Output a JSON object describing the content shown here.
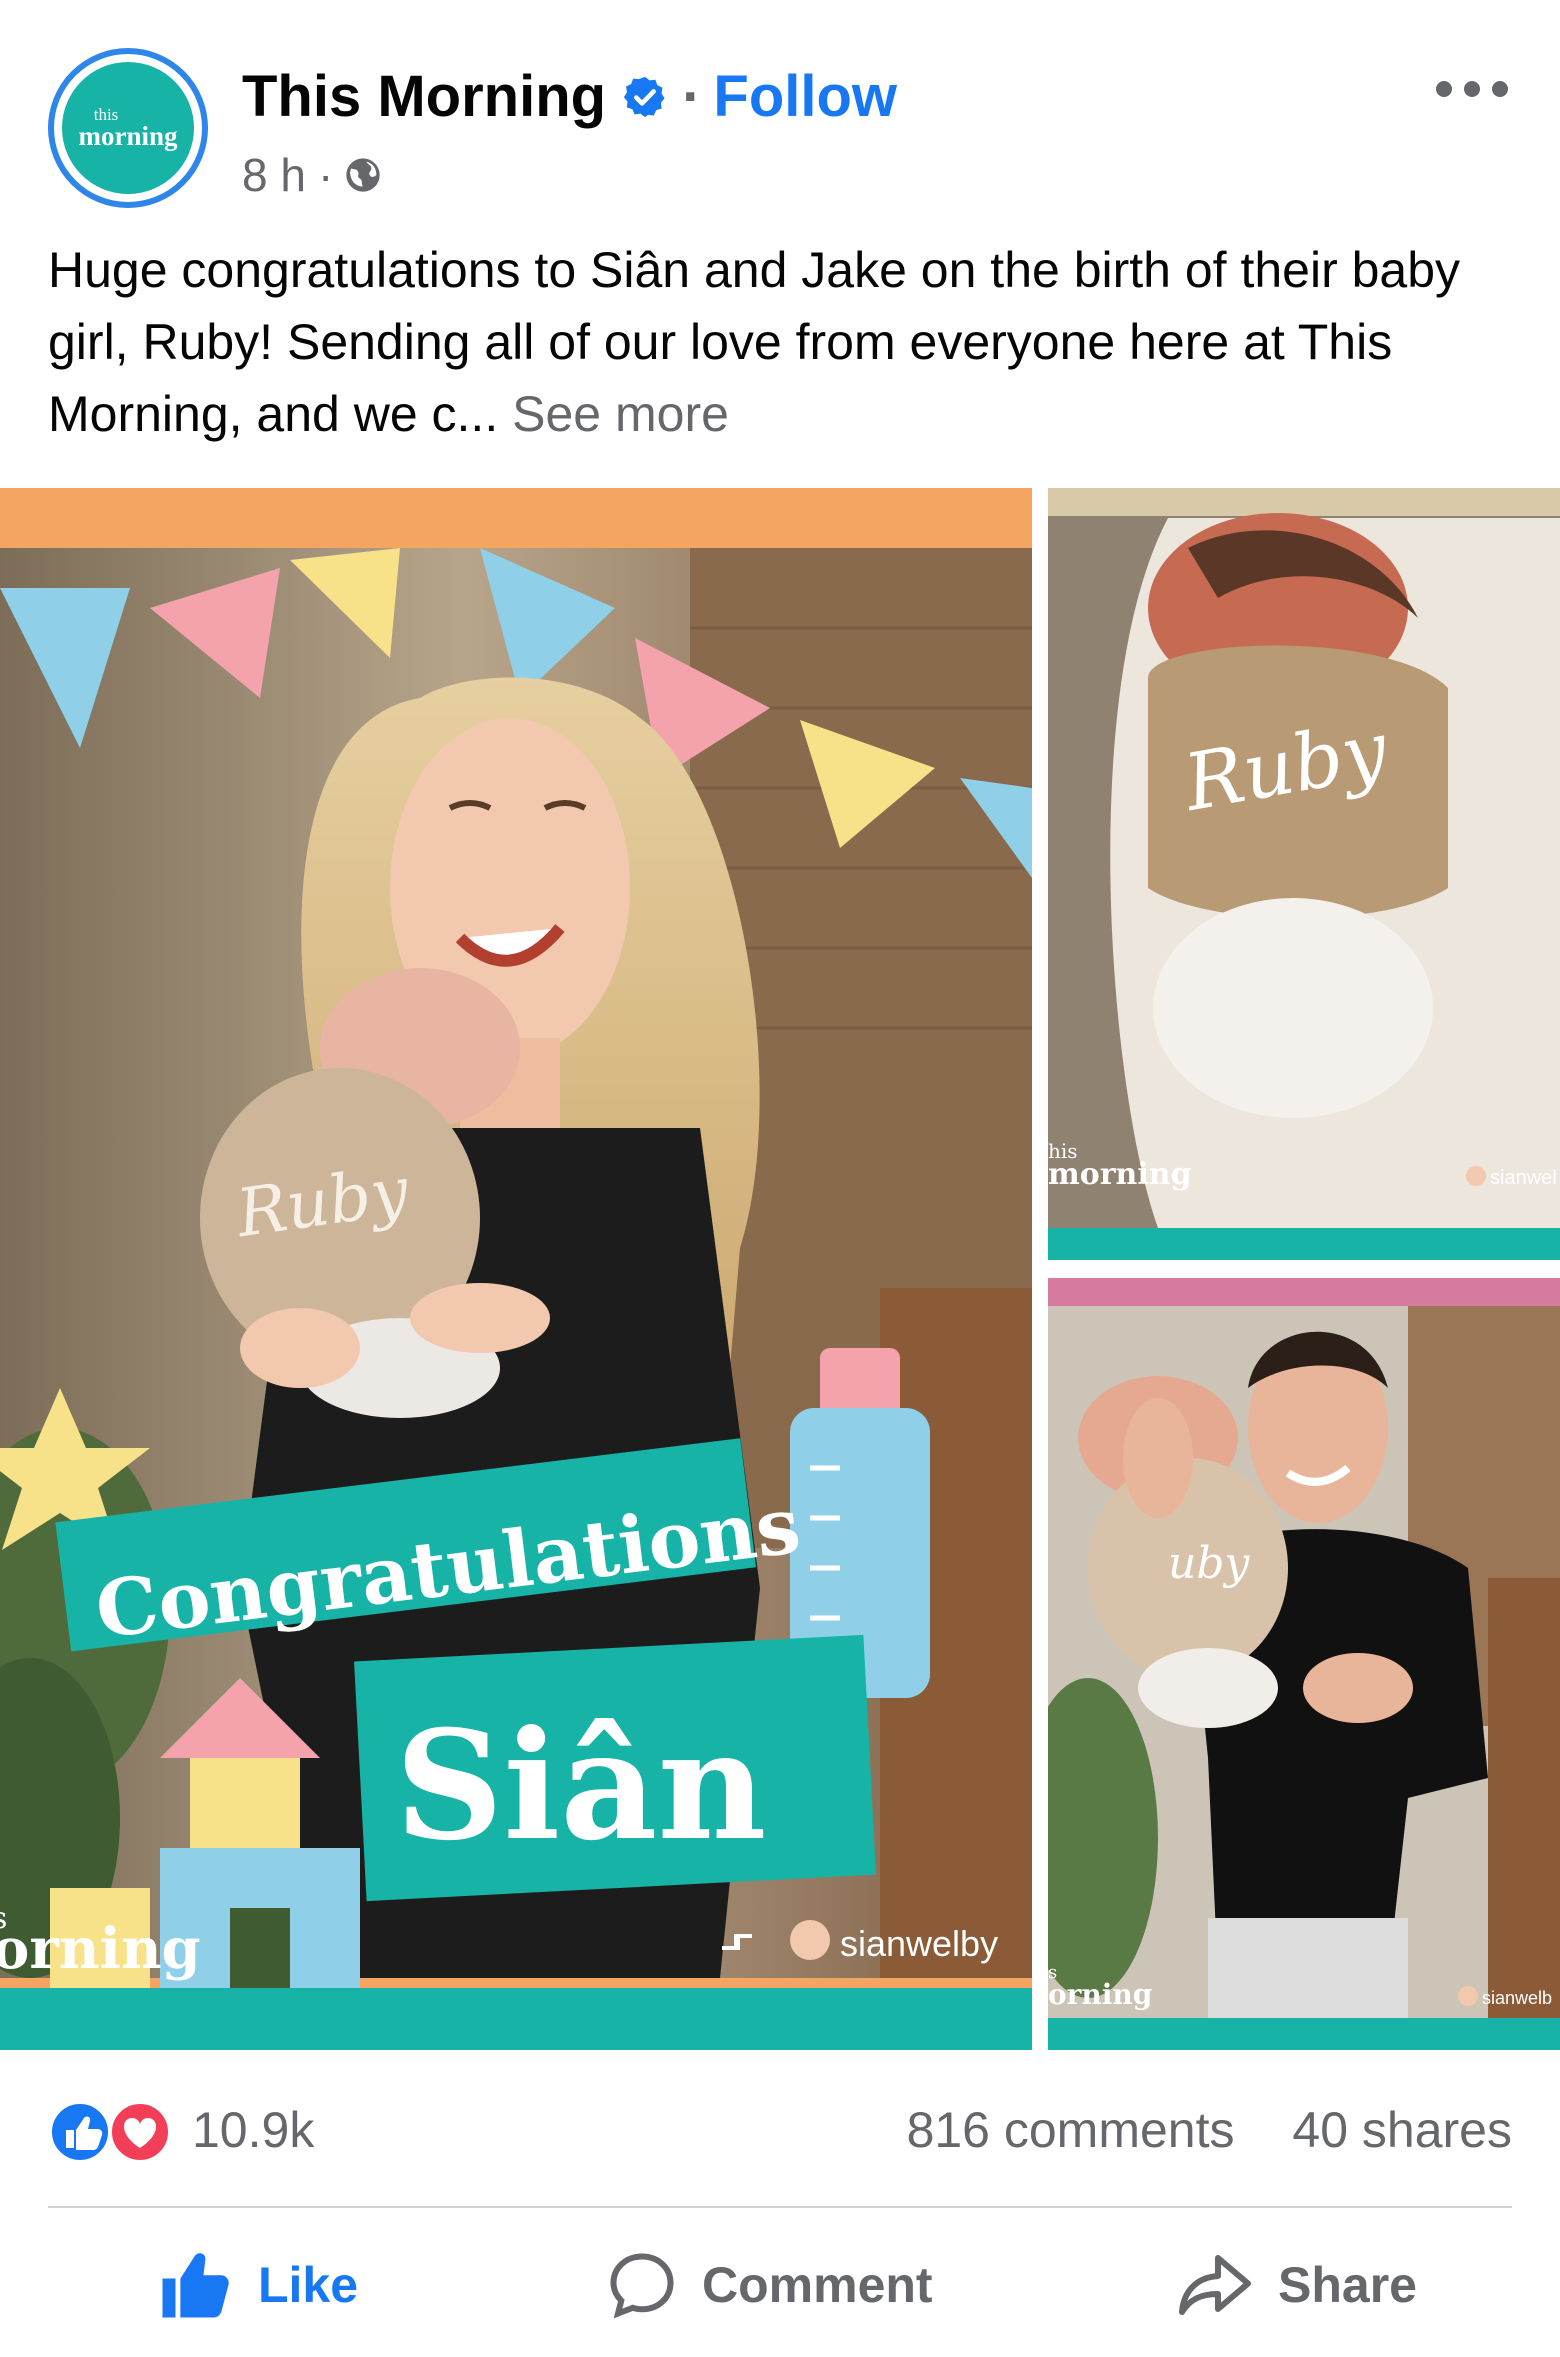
{
  "post": {
    "page_name": "This Morning",
    "follow_label": "Follow",
    "separator": "·",
    "time": "8 h",
    "time_sep": "·",
    "avatar": {
      "text_small": "this",
      "text_big": "morning"
    },
    "caption": "Huge congratulations to Siân and Jake on the birth of their baby girl, Ruby! Sending all of our love from everyone here at This Morning, and we c...",
    "see_more": "See more"
  },
  "images": {
    "main": {
      "banner_line1": "Congratulations",
      "banner_line2": "Siân",
      "sweater_text": "Ruby",
      "watermark": "orning",
      "watermark_top": "s",
      "credit": "sianwelby"
    },
    "baby": {
      "sweater_text": "Ruby",
      "watermark_top": "his",
      "watermark": "morning",
      "credit": "sianwel"
    },
    "dad": {
      "sweater_text": "uby",
      "watermark_top": "s",
      "watermark": "orning",
      "credit": "sianwelb"
    }
  },
  "engagement": {
    "reactions_count": "10.9k",
    "comments": "816 comments",
    "shares": "40 shares"
  },
  "actions": {
    "like": "Like",
    "comment": "Comment",
    "share": "Share"
  },
  "colors": {
    "facebook_blue": "#1877f2",
    "love_red": "#f33e58",
    "teal": "#17b3a6",
    "secondary_text": "#65676b"
  },
  "icons": [
    "verified-badge-icon",
    "globe-icon",
    "more-options-icon",
    "like-reaction-icon",
    "love-reaction-icon",
    "thumbs-up-icon",
    "comment-bubble-icon",
    "share-arrow-icon",
    "repost-icon"
  ]
}
